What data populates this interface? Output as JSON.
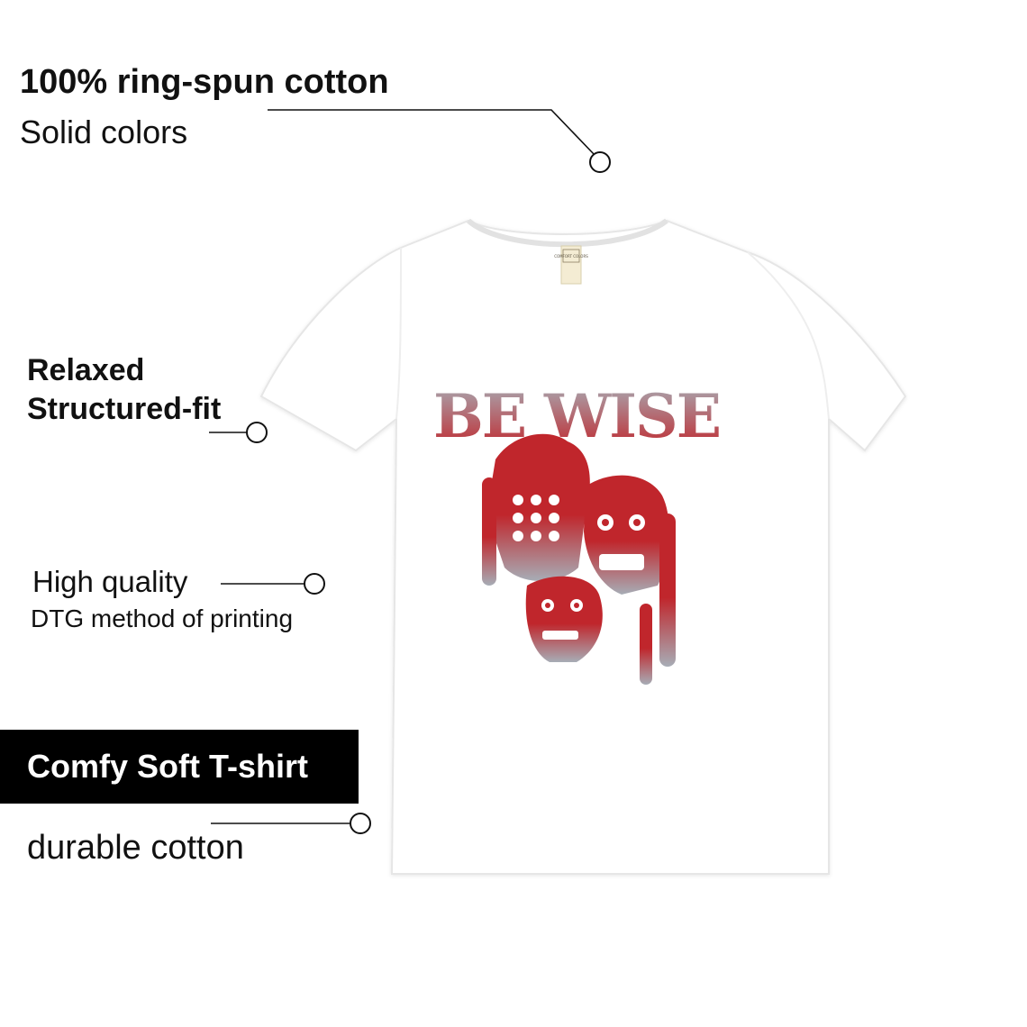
{
  "features": {
    "cotton_title": "100% ring-spun cotton",
    "cotton_sub": "Solid colors",
    "fit_title": "Relaxed",
    "fit_sub": "Structured-fit",
    "quality_title": "High quality",
    "quality_sub": "DTG method of printing",
    "badge_label": "Comfy Soft T-shirt",
    "durable_label": "durable cotton"
  },
  "shirt": {
    "graphic_text": "BE WISE",
    "tag_label": "COMFORT COLORS",
    "shirt_color": "#ffffff",
    "graphic_red": "#c0262c",
    "graphic_gray": "#a7adb6",
    "icon": "skull-graphic"
  }
}
